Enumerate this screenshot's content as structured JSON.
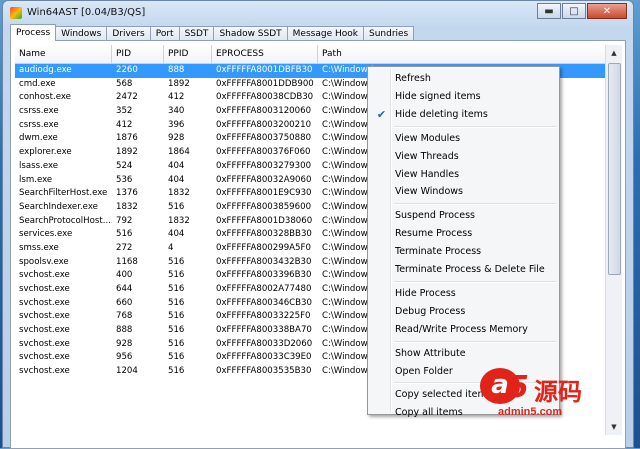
{
  "window": {
    "title": "Win64AST [0.04/B3/QS]",
    "controls": {
      "minimize": "▬",
      "maximize": "□",
      "close": "✕"
    }
  },
  "tabs": [
    "Process",
    "Windows",
    "Drivers",
    "Port",
    "SSDT",
    "Shadow SSDT",
    "Message Hook",
    "Sundries"
  ],
  "active_tab": "Process",
  "columns": [
    "Name",
    "PID",
    "PPID",
    "EPROCESS",
    "Path"
  ],
  "rows": [
    [
      "audiodg.exe",
      "2260",
      "888",
      "0xFFFFFA8001DBFB30",
      "C:\\Windows\\"
    ],
    [
      "cmd.exe",
      "568",
      "1892",
      "0xFFFFFA8001DDB900",
      "C:\\Windows\\"
    ],
    [
      "conhost.exe",
      "2472",
      "412",
      "0xFFFFFA80038CDB30",
      "C:\\Windows\\"
    ],
    [
      "csrss.exe",
      "352",
      "340",
      "0xFFFFFA8003120060",
      "C:\\Windows\\"
    ],
    [
      "csrss.exe",
      "412",
      "396",
      "0xFFFFFA8003200210",
      "C:\\Windows\\"
    ],
    [
      "dwm.exe",
      "1876",
      "928",
      "0xFFFFFA8003750880",
      "C:\\Windows\\"
    ],
    [
      "explorer.exe",
      "1892",
      "1864",
      "0xFFFFFA800376F060",
      "C:\\Windows\\"
    ],
    [
      "lsass.exe",
      "524",
      "404",
      "0xFFFFFA8003279300",
      "C:\\Windows\\"
    ],
    [
      "lsm.exe",
      "536",
      "404",
      "0xFFFFFA80032A9060",
      "C:\\Windows\\"
    ],
    [
      "SearchFilterHost.exe",
      "1376",
      "1832",
      "0xFFFFFA8001E9C930",
      "C:\\Windows\\"
    ],
    [
      "SearchIndexer.exe",
      "1832",
      "516",
      "0xFFFFFA8003859600",
      "C:\\Windows\\"
    ],
    [
      "SearchProtocolHost....",
      "792",
      "1832",
      "0xFFFFFA8001D38060",
      "C:\\Windows\\"
    ],
    [
      "services.exe",
      "516",
      "404",
      "0xFFFFFA800328BB30",
      "C:\\Windows\\"
    ],
    [
      "smss.exe",
      "272",
      "4",
      "0xFFFFFA800299A5F0",
      "C:\\Windows\\"
    ],
    [
      "spoolsv.exe",
      "1168",
      "516",
      "0xFFFFFA8003432B30",
      "C:\\Windows\\"
    ],
    [
      "svchost.exe",
      "400",
      "516",
      "0xFFFFFA8003396B30",
      "C:\\Windows\\"
    ],
    [
      "svchost.exe",
      "644",
      "516",
      "0xFFFFFA8002A77480",
      "C:\\Windows\\"
    ],
    [
      "svchost.exe",
      "660",
      "516",
      "0xFFFFFA800346CB30",
      "C:\\Windows\\"
    ],
    [
      "svchost.exe",
      "768",
      "516",
      "0xFFFFFA80033225F0",
      "C:\\Windows\\"
    ],
    [
      "svchost.exe",
      "888",
      "516",
      "0xFFFFFA800338BA70",
      "C:\\Windows\\"
    ],
    [
      "svchost.exe",
      "928",
      "516",
      "0xFFFFFA80033D2060",
      "C:\\Windows\\"
    ],
    [
      "svchost.exe",
      "956",
      "516",
      "0xFFFFFA80033C39E0",
      "C:\\Windows\\"
    ],
    [
      "svchost.exe",
      "1204",
      "516",
      "0xFFFFFA8003535B30",
      "C:\\Windows\\"
    ]
  ],
  "selected_row": 0,
  "context_menu": {
    "items": [
      {
        "label": "Refresh"
      },
      {
        "label": "Hide signed items"
      },
      {
        "label": "Hide deleting items",
        "checked": true
      },
      {
        "separator": true
      },
      {
        "label": "View Modules"
      },
      {
        "label": "View Threads"
      },
      {
        "label": "View Handles"
      },
      {
        "label": "View Windows"
      },
      {
        "separator": true
      },
      {
        "label": "Suspend Process"
      },
      {
        "label": "Resume Process"
      },
      {
        "label": "Terminate Process"
      },
      {
        "label": "Terminate Process & Delete File"
      },
      {
        "separator": true
      },
      {
        "label": "Hide Process"
      },
      {
        "label": "Debug Process"
      },
      {
        "label": "Read/Write Process Memory"
      },
      {
        "separator": true
      },
      {
        "label": "Show Attribute"
      },
      {
        "label": "Open Folder"
      },
      {
        "separator": true
      },
      {
        "label": "Copy selected items"
      },
      {
        "label": "Copy all items"
      }
    ],
    "check_glyph": "✔"
  },
  "watermark": {
    "logo_letter": "a",
    "logo_digit": "5",
    "cn_text": "源码",
    "url": "admin5.com"
  },
  "icons": {
    "app": "app-icon",
    "scroll_up": "▲",
    "scroll_down": "▼"
  },
  "colors": {
    "selection": "#3399ff",
    "menu_bg": "#f5f6f7",
    "brand": "#e2231a"
  }
}
